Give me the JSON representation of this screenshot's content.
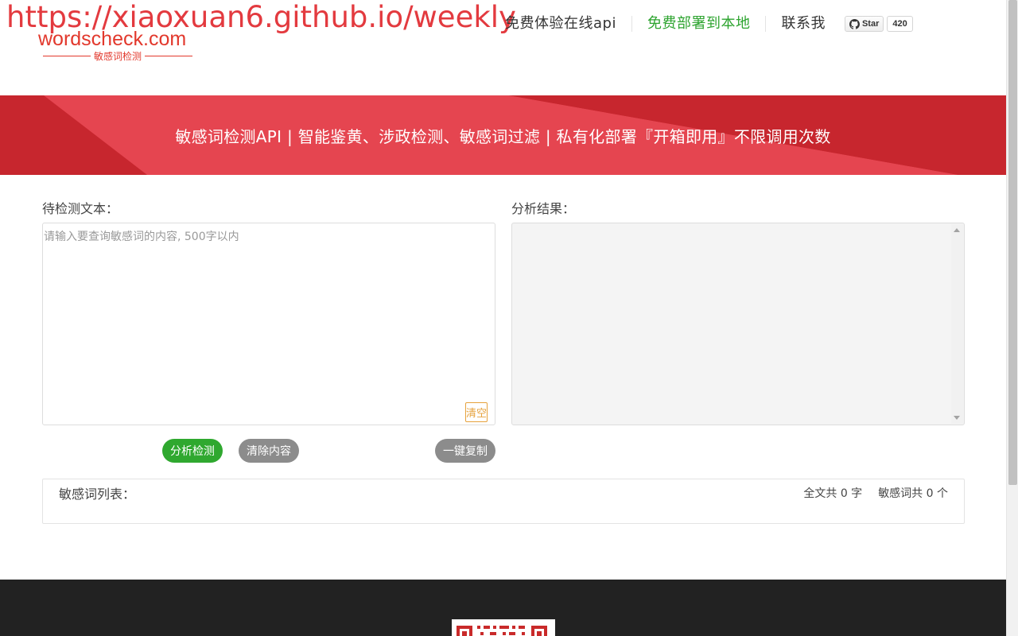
{
  "watermark": "https://xiaoxuan6.github.io/weekly",
  "logo": {
    "main": "wordscheck.com",
    "sub": "敏感词检测"
  },
  "nav": {
    "items": [
      "免费体验在线api",
      "免费部署到本地",
      "联系我"
    ],
    "github": {
      "star_label": "Star",
      "count": "420",
      "icon": "github-icon"
    }
  },
  "banner": {
    "title": "敏感词检测API | 智能鉴黄、涉政检测、敏感词过滤 | 私有化部署『开箱即用』不限调用次数"
  },
  "input_panel": {
    "label": "待检测文本：",
    "placeholder": "请输入要查询敏感词的内容, 500字以内",
    "value": "",
    "clear_label": "清空"
  },
  "result_panel": {
    "label": "分析结果："
  },
  "actions": {
    "analyze": "分析检测",
    "clear": "清除内容",
    "copy": "一键复制"
  },
  "word_list": {
    "label": "敏感词列表：",
    "total_chars": "全文共 0 字",
    "sensitive_count": "敏感词共 0 个"
  },
  "colors": {
    "brand_red": "#e2382c",
    "banner_red": "#c7262e",
    "accent_green": "#2fa82f",
    "footer_bg": "#222222"
  }
}
